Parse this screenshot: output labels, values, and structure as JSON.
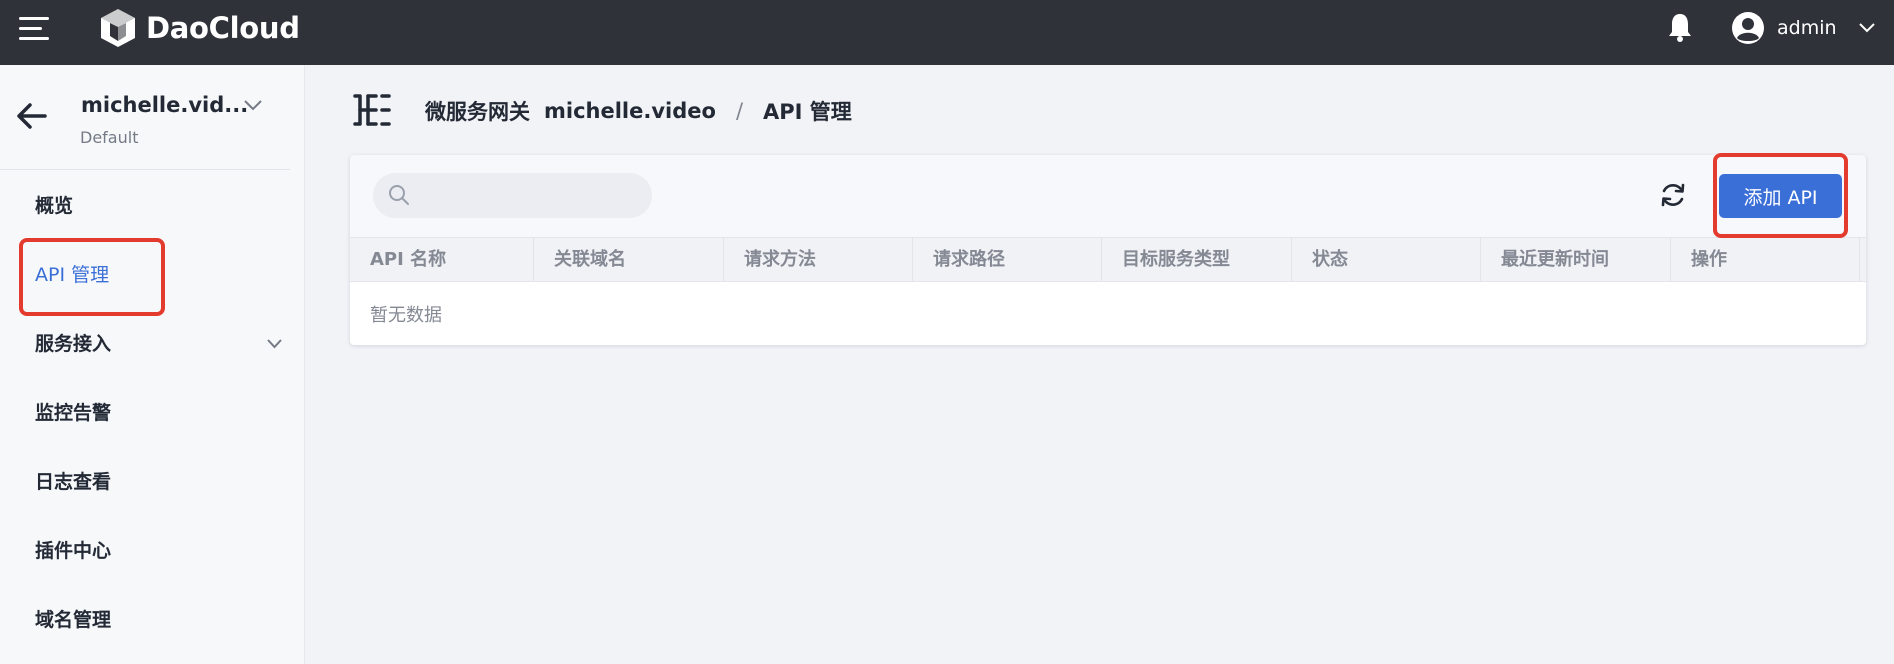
{
  "topbar": {
    "brand": "DaoCloud",
    "user_name": "admin"
  },
  "sidebar": {
    "namespace_name": "michelle.vid...",
    "namespace_sub": "Default",
    "items": [
      {
        "label": "概览"
      },
      {
        "label": "API 管理"
      },
      {
        "label": "服务接入"
      },
      {
        "label": "监控告警"
      },
      {
        "label": "日志查看"
      },
      {
        "label": "插件中心"
      },
      {
        "label": "域名管理"
      }
    ]
  },
  "breadcrumb": {
    "root": "微服务网关",
    "gateway": "michelle.video",
    "separator": "/",
    "current": "API 管理"
  },
  "toolbar": {
    "search_placeholder": "",
    "add_button": "添加 API"
  },
  "table": {
    "columns": [
      "API 名称",
      "关联域名",
      "请求方法",
      "请求路径",
      "目标服务类型",
      "状态",
      "最近更新时间",
      "操作"
    ],
    "empty_text": "暂无数据"
  },
  "colors": {
    "topbar": "#2f3239",
    "accent": "#3a6fd8",
    "highlight": "#e33b2e"
  }
}
